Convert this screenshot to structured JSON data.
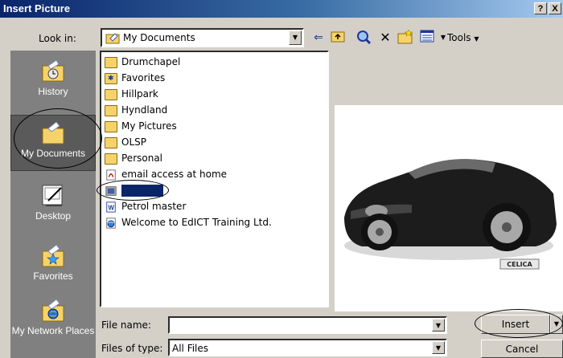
{
  "window": {
    "title": "Insert Picture",
    "help_btn": "?",
    "close_btn": "X"
  },
  "toolbar": {
    "look_in_label": "Look in:",
    "look_in_value": "My Documents",
    "tools_label": "Tools"
  },
  "places": [
    {
      "label": "History",
      "icon": "history-icon"
    },
    {
      "label": "My Documents",
      "icon": "my-documents-icon"
    },
    {
      "label": "Desktop",
      "icon": "desktop-icon"
    },
    {
      "label": "Favorites",
      "icon": "favorites-icon"
    },
    {
      "label": "My Network Places",
      "icon": "network-places-icon"
    }
  ],
  "files": [
    {
      "name": "Drumchapel",
      "type": "folder"
    },
    {
      "name": "Favorites",
      "type": "folder"
    },
    {
      "name": "Hillpark",
      "type": "folder"
    },
    {
      "name": "Hyndland",
      "type": "folder"
    },
    {
      "name": "My Pictures",
      "type": "folder"
    },
    {
      "name": "OLSP",
      "type": "folder"
    },
    {
      "name": "Personal",
      "type": "folder"
    },
    {
      "name": "email access at home",
      "type": "pdf"
    },
    {
      "name": "",
      "type": "image",
      "selected": true
    },
    {
      "name": "Petrol master",
      "type": "word"
    },
    {
      "name": "Welcome to EdICT Training Ltd.",
      "type": "web"
    }
  ],
  "preview": {
    "badge": "CELICA"
  },
  "form": {
    "file_name_label": "File name:",
    "file_name_value": "",
    "file_type_label": "Files of type:",
    "file_type_value": "All Files",
    "insert_label": "Insert",
    "cancel_label": "Cancel"
  },
  "colors": {
    "title_bar": "#0a246a",
    "places_bg": "#808080",
    "selection": "#0a246a",
    "face": "#d4d0c8"
  }
}
